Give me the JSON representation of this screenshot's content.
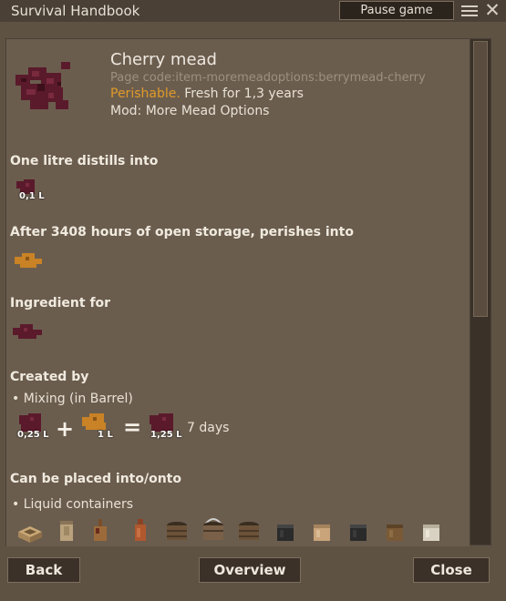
{
  "window": {
    "title": "Survival Handbook",
    "pause_label": "Pause game"
  },
  "item": {
    "name": "Cherry mead",
    "page_code": "Page code:item-moremeadoptions:berrymead-cherry",
    "perishable_label": "Perishable.",
    "fresh_text": " Fresh for 1,3 years",
    "mod": "Mod: More Mead Options"
  },
  "sections": {
    "distills": {
      "heading": "One litre distills into",
      "qty": "0,1 L"
    },
    "perishes": {
      "heading": "After 3408 hours of open storage, perishes into"
    },
    "ingredient": {
      "heading": "Ingredient for"
    },
    "created": {
      "heading": "Created by",
      "method": "• Mixing (in Barrel)",
      "input1_qty": "0,25 L",
      "plus": "+",
      "input2_qty": "1 L",
      "equals": "=",
      "output_qty": "1,25 L",
      "duration": "7 days"
    },
    "placed": {
      "heading": "Can be placed into/onto",
      "item": "• Liquid containers"
    }
  },
  "containers": [
    "crock-icon",
    "bucket-clay-icon",
    "bottle-icon",
    "jug-icon",
    "wood-bucket-icon",
    "wood-bucket-handle-icon",
    "wood-bucket-icon",
    "black-pot-icon",
    "clay-pot-icon",
    "black-pot-icon",
    "wood-pot-icon",
    "white-jar-icon"
  ],
  "buttons": {
    "back": "Back",
    "overview": "Overview",
    "close": "Close"
  },
  "colors": {
    "accent_perishable": "#e09a2a",
    "mead": "#5a1a2b",
    "pollen": "#c98225"
  }
}
